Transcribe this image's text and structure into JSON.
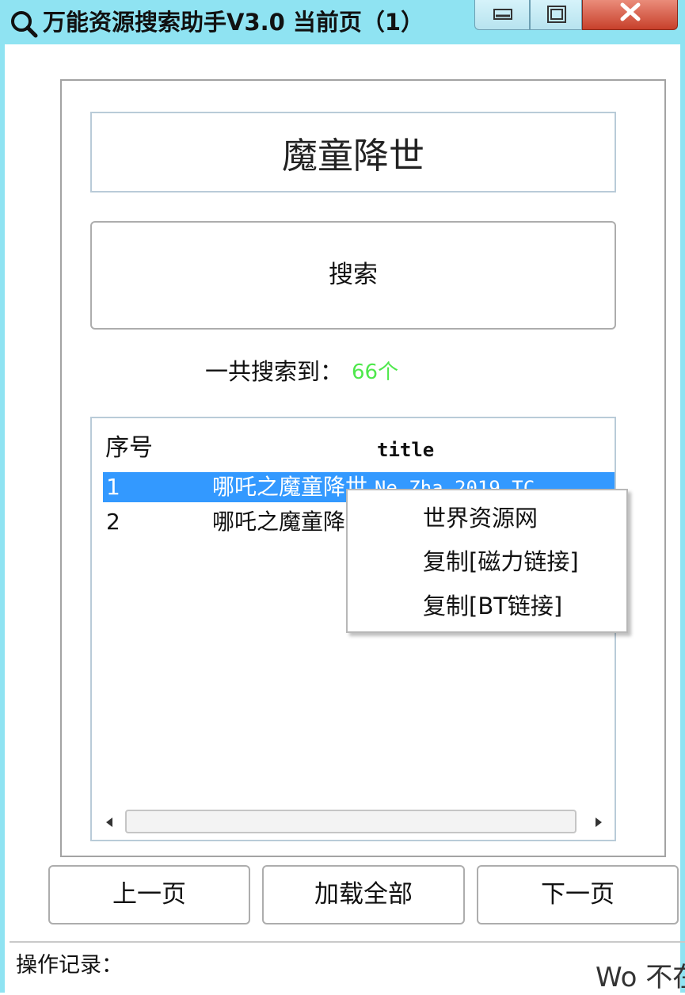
{
  "window": {
    "title": "万能资源搜索助手V3.0  当前页（1）",
    "icon": "magnifier-icon",
    "controls": {
      "minimize": "minimize-icon",
      "maximize": "maximize-icon",
      "close": "close-icon"
    },
    "frame_color": "#8fe3f2"
  },
  "search": {
    "query": "魔童降世",
    "button_label": "搜索"
  },
  "results": {
    "count_label": "一共搜索到：",
    "count_value": "66个",
    "count_color": "#4ee84b",
    "columns": [
      "序号",
      "title"
    ],
    "rows": [
      {
        "index": "1",
        "title_cjk": "哪吒之魔童降世.",
        "title_latin": "Ne.Zha.2019.TC"
      },
      {
        "index": "2",
        "title_cjk": "哪吒之魔童降世",
        "title_latin": ""
      }
    ],
    "selected_color": "#3399ff"
  },
  "context_menu": {
    "items": [
      "世界资源网",
      "复制[磁力链接]",
      "复制[BT链接]"
    ]
  },
  "nav": {
    "prev": "上一页",
    "load_all": "加载全部",
    "next": "下一页"
  },
  "log": {
    "label": "操作记录："
  },
  "watermark": {
    "text": "Wo 不在"
  }
}
